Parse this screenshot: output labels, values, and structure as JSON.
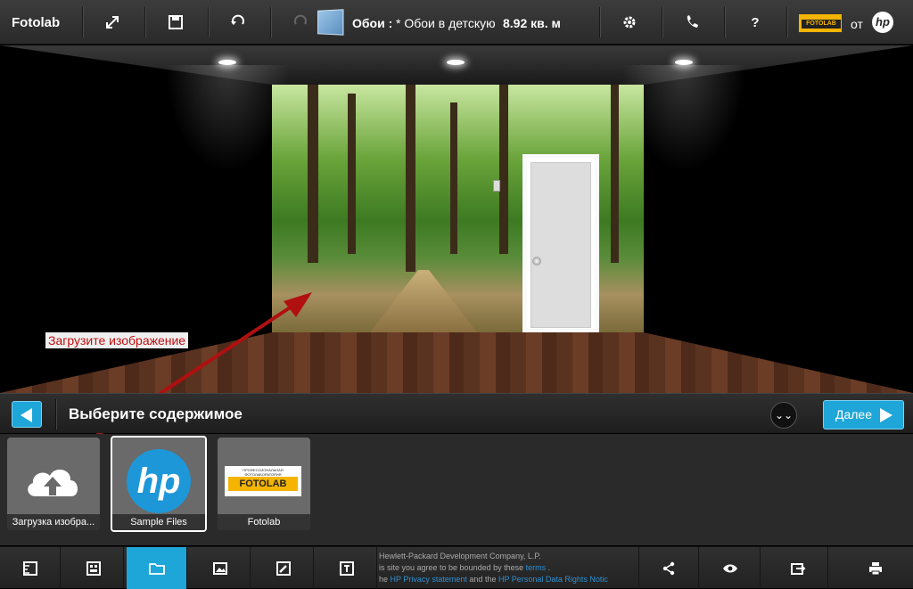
{
  "app": {
    "name": "Fotolab"
  },
  "toolbar": {
    "title_label": "Обои :",
    "title_name": "* Обои в детскую",
    "area": "8.92 кв. м",
    "fotolab_logo_text": "FOTOLAB",
    "from_label": "от",
    "hp_logo_text": "hp",
    "help_label": "?"
  },
  "scene": {
    "hint": "Загрузите изображение"
  },
  "content_bar": {
    "title": "Выберите содержимое",
    "next_label": "Далее",
    "collapse_label": "⌄⌄"
  },
  "tiles": [
    {
      "caption": "Загрузка изобра...",
      "selected": false
    },
    {
      "caption": "Sample Files",
      "selected": true,
      "logo_text": "hp"
    },
    {
      "caption": "Fotolab",
      "selected": false,
      "logo_text": "FOTOLAB",
      "logo_subtext": "ПРОФЕССИОНАЛЬНАЯ ФОТОЛАБОРАТОРИЯ"
    }
  ],
  "footer": {
    "line1": "Hewlett-Packard Development Company, L.P.",
    "line2_a": "is site you agree to be bounded by these",
    "line2_link": "terms",
    "line2_b": ".",
    "line3_a": "he",
    "line3_link1": "HP Privacy statement",
    "line3_b": "and the",
    "line3_link2": "HP Personal Data Rights Notic"
  },
  "colors": {
    "accent": "#1fa6d9",
    "hint_text": "#c01010",
    "arrow": "#b01010"
  }
}
